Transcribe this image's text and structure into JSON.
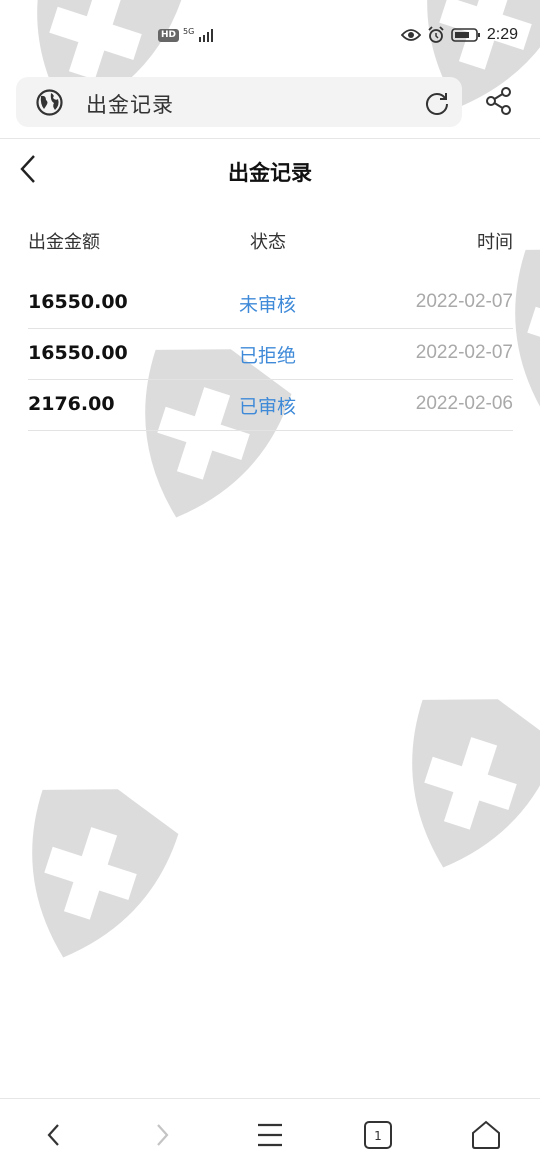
{
  "status_bar": {
    "hd_label": "HD",
    "network_label": "5G",
    "time": "2:29"
  },
  "address_bar": {
    "url_text": "出金记录"
  },
  "page": {
    "title": "出金记录"
  },
  "table": {
    "headers": {
      "amount": "出金金额",
      "status": "状态",
      "time": "时间"
    },
    "rows": [
      {
        "amount": "16550.00",
        "status": "未审核",
        "time": "2022-02-07"
      },
      {
        "amount": "16550.00",
        "status": "已拒绝",
        "time": "2022-02-07"
      },
      {
        "amount": "2176.00",
        "status": "已审核",
        "time": "2022-02-06"
      }
    ]
  },
  "bottom_nav": {
    "tab_count": "1"
  },
  "colors": {
    "status_link": "#3f8ad8",
    "date_gray": "#a9a9a9",
    "watermark": "#9a9a9a"
  }
}
